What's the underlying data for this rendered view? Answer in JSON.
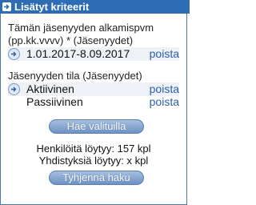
{
  "panel": {
    "title": "Lisätyt kriteerit",
    "date_section": {
      "label_line1": "Tämän jäsenyyden alkamispvm",
      "label_line2": "(pp.kk.vvvv) * (Jäsenyydet)",
      "value": "1.01.2017-8.09.2017",
      "remove_label": "poista"
    },
    "status_section": {
      "label": "Jäsenyyden tila (Jäsenyydet)",
      "items": [
        {
          "label": "Aktiivinen",
          "remove_label": "poista"
        },
        {
          "label": "Passiivinen",
          "remove_label": "poista"
        }
      ]
    },
    "search_button_label": "Hae valituilla",
    "person_count_text": "Henkilöitä löytyy: 157 kpl",
    "association_count_text": "Yhdistyksiä löytyy: x kpl",
    "clear_button_label": "Tyhjennä haku"
  },
  "icons": {
    "header_icon": "arrow-right-icon",
    "row_icon": "circle-arrow-right-icon"
  },
  "colors": {
    "header_bg": "#2e6db4",
    "link": "#2b5fa8",
    "button_top": "#a6bfdf",
    "button_bottom": "#6e92c2"
  }
}
